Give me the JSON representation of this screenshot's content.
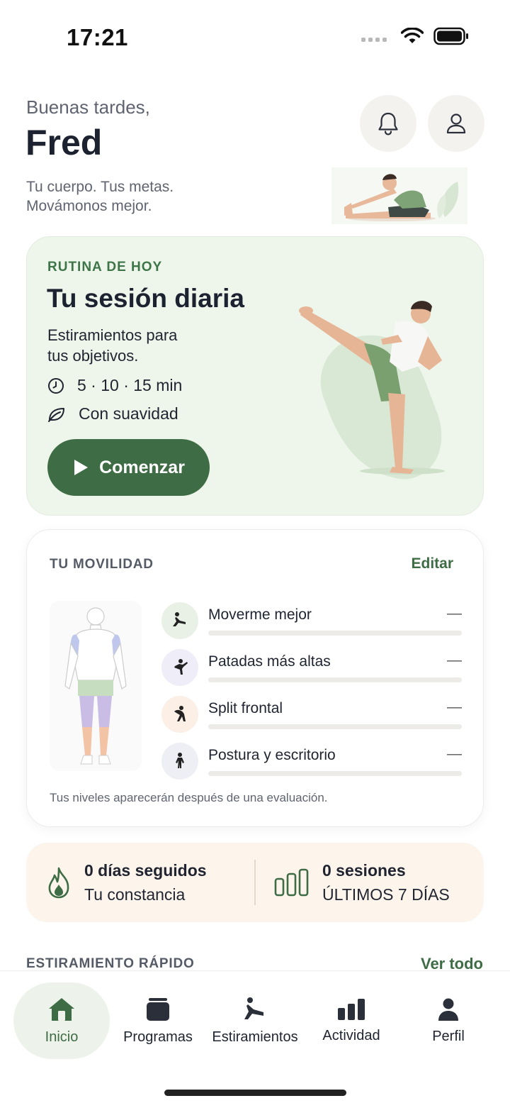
{
  "status_bar": {
    "time": "17:21"
  },
  "header": {
    "greeting": "Buenas tardes,",
    "name": "Fred",
    "tagline": "Tu cuerpo. Tus metas.\nMovámonos mejor."
  },
  "today": {
    "eyebrow": "RUTINA DE HOY",
    "title": "Tu sesión diaria",
    "description": "Estiramientos para\ntus objetivos.",
    "duration": "5 · 10 · 15 min",
    "intensity": "Con suavidad",
    "start_label": "Comenzar"
  },
  "mobility": {
    "title": "TU MOVILIDAD",
    "edit_label": "Editar",
    "goals": [
      {
        "label": "Moverme mejor",
        "value": "—",
        "icon": "lunge-icon",
        "icon_bg": "#e9f1e6"
      },
      {
        "label": "Patadas más altas",
        "value": "—",
        "icon": "kick-icon",
        "icon_bg": "#efedf8"
      },
      {
        "label": "Split frontal",
        "value": "—",
        "icon": "stretch-icon",
        "icon_bg": "#fbefe6"
      },
      {
        "label": "Postura y escritorio",
        "value": "—",
        "icon": "posture-icon",
        "icon_bg": "#edeff5"
      }
    ],
    "note": "Tus niveles aparecerán después de una evaluación."
  },
  "stats": {
    "streak_value": "0 días seguidos",
    "streak_caption": "Tu constancia",
    "sessions_value": "0 sesiones",
    "sessions_caption": "ÚLTIMOS 7 DÍAS"
  },
  "quick_stretch": {
    "title": "ESTIRAMIENTO RÁPIDO",
    "see_all": "Ver todo"
  },
  "nav": {
    "items": [
      {
        "label": "Inicio",
        "icon": "home-icon",
        "active": true
      },
      {
        "label": "Programas",
        "icon": "programs-icon",
        "active": false
      },
      {
        "label": "Estiramientos",
        "icon": "stretch-icon",
        "active": false
      },
      {
        "label": "Actividad",
        "icon": "activity-icon",
        "active": false
      },
      {
        "label": "Perfil",
        "icon": "profile-icon",
        "active": false
      }
    ]
  },
  "colors": {
    "accent": "#3e6c44",
    "card_green": "#eef6ec",
    "card_peach": "#fdf4ec"
  }
}
